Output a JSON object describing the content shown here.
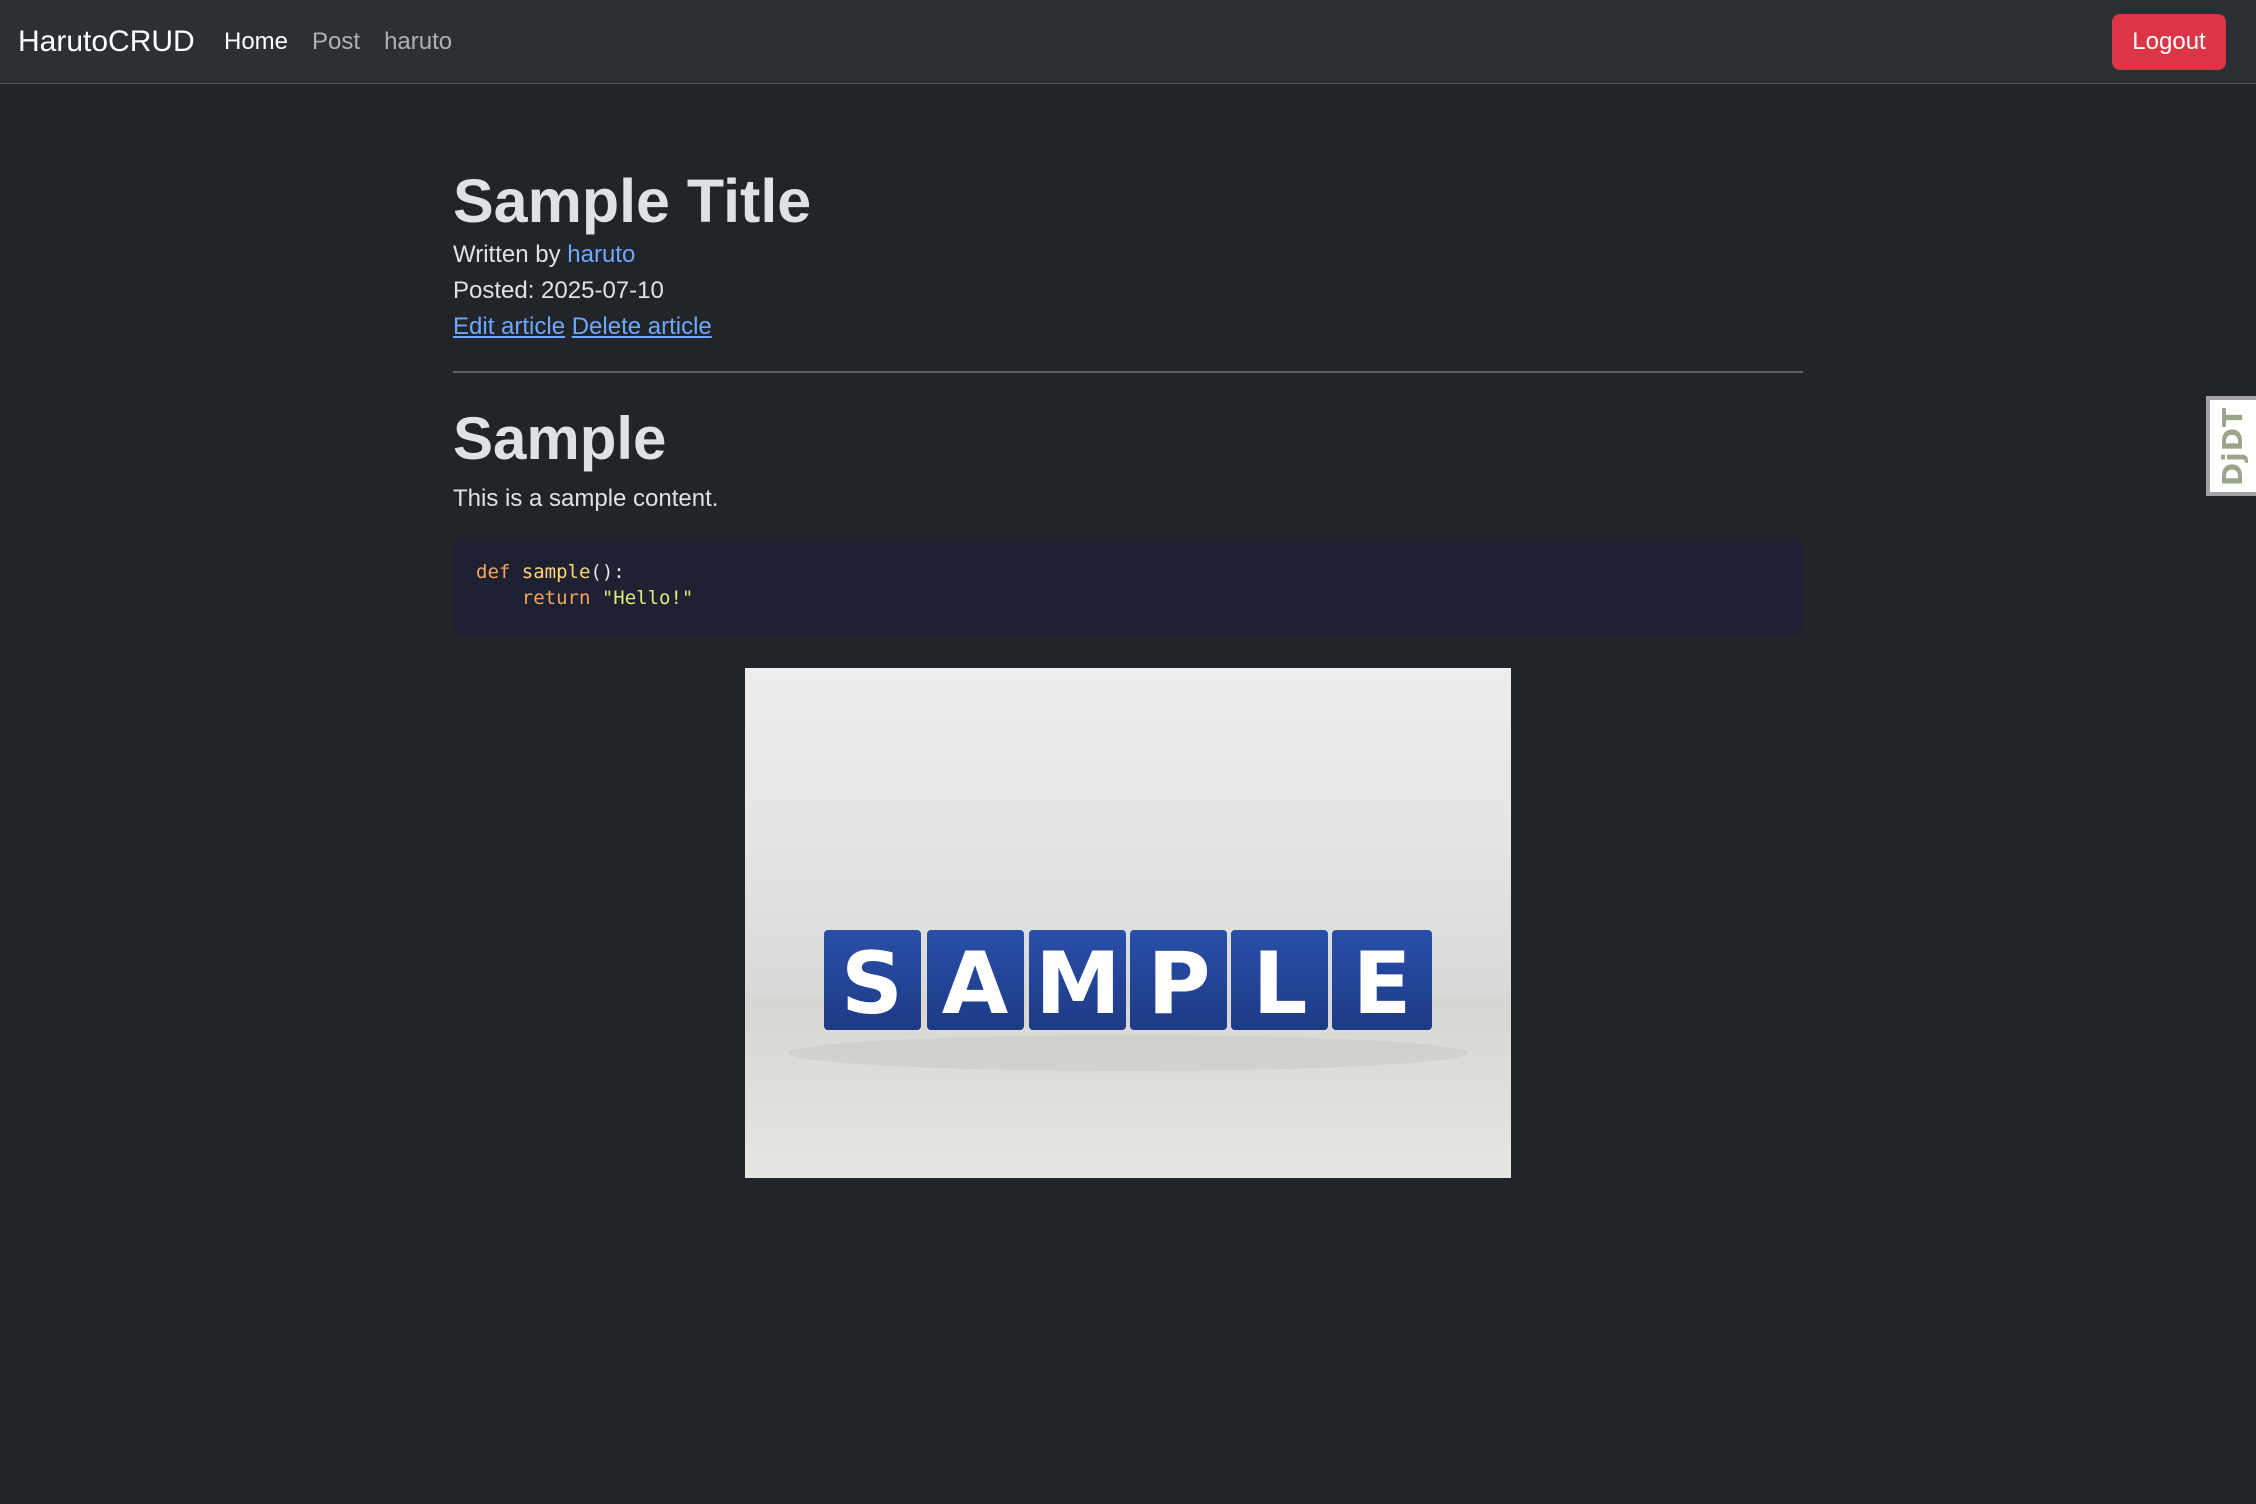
{
  "navbar": {
    "brand": "HarutoCRUD",
    "links": [
      {
        "label": "Home",
        "active": true
      },
      {
        "label": "Post",
        "active": false
      },
      {
        "label": "haruto",
        "active": false
      }
    ],
    "logout_label": "Logout"
  },
  "article": {
    "title": "Sample Title",
    "written_by_prefix": "Written by ",
    "author": "haruto",
    "posted": "Posted: 2025-07-10",
    "edit_label": "Edit article",
    "delete_label": "Delete article",
    "content_heading": "Sample",
    "content_text": "This is a sample content.",
    "code": {
      "line1_kw": "def",
      "line1_fn": "sample",
      "line1_punc": "():",
      "line2_indent": "    ",
      "line2_kw": "return",
      "line2_str": "\"Hello!\""
    },
    "image_text": "SAMPLE"
  },
  "debug_toolbar": {
    "label": "DjDT"
  },
  "colors": {
    "background": "#212529",
    "navbar": "#2b3035",
    "link": "#6ea8fe",
    "danger": "#dc3545",
    "code_bg": "#1e2132"
  }
}
